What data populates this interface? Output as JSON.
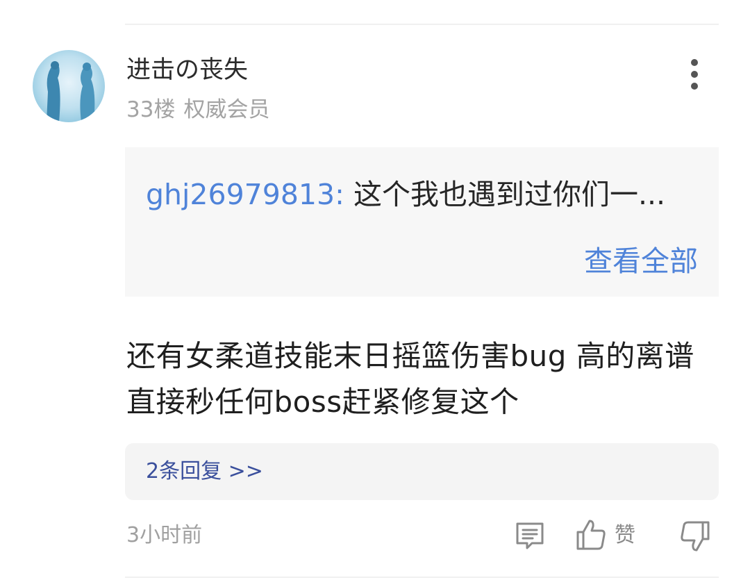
{
  "post": {
    "username": "进击の丧失",
    "floor": "33楼",
    "badge": "权威会员"
  },
  "quote": {
    "user": "ghj26979813:",
    "text": " 这个我也遇到过你们一...",
    "view_all": "查看全部"
  },
  "comment": {
    "text": "还有女柔道技能末日摇篮伤害bug  高的离谱直接秒任何boss赶紧修复这个"
  },
  "replies": {
    "label": "2条回复 >>"
  },
  "footer": {
    "time": "3小时前",
    "like_label": "赞"
  },
  "icons": {
    "more": "more-vertical-icon",
    "reply": "comment-icon",
    "like": "thumbs-up-icon",
    "dislike": "thumbs-down-icon"
  },
  "colors": {
    "link": "#4f83d9",
    "reply_link": "#3a4f9c",
    "muted": "#a3a3a3",
    "icon": "#8a8a8a"
  }
}
